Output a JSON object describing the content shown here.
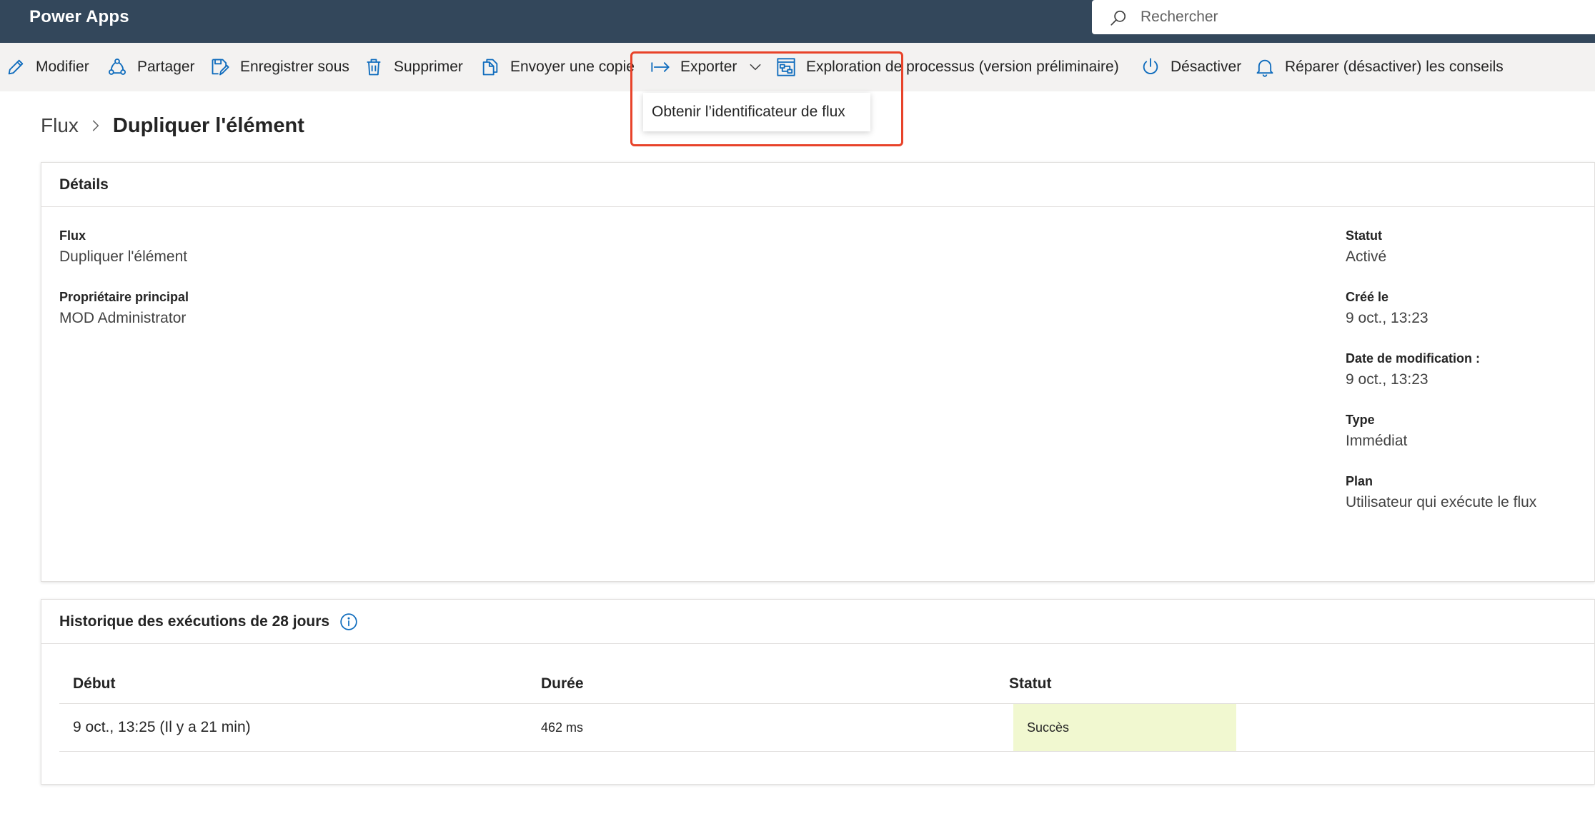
{
  "app": {
    "title": "Power Apps"
  },
  "search": {
    "placeholder": "Rechercher"
  },
  "commandbar": {
    "items": [
      {
        "label": "Modifier",
        "icon": "pencil-icon"
      },
      {
        "label": "Partager",
        "icon": "share-icon"
      },
      {
        "label": "Enregistrer sous",
        "icon": "save-as-icon"
      },
      {
        "label": "Supprimer",
        "icon": "trash-icon"
      },
      {
        "label": "Envoyer une copie",
        "icon": "copy-icon"
      },
      {
        "label": "Exporter",
        "icon": "export-arrow-icon"
      },
      {
        "label": "Exploration de processus (version préliminaire)",
        "icon": "process-mining-icon"
      },
      {
        "label": "Désactiver",
        "icon": "power-icon"
      },
      {
        "label": "Réparer (désactiver) les conseils",
        "icon": "bell-icon"
      }
    ]
  },
  "export_menu": {
    "items": [
      {
        "label": "Obtenir l’identificateur de flux"
      }
    ]
  },
  "breadcrumb": {
    "root": "Flux",
    "current": "Dupliquer l'élément"
  },
  "details": {
    "title": "Détails",
    "left": [
      {
        "label": "Flux",
        "value": "Dupliquer l'élément"
      },
      {
        "label": "Propriétaire principal",
        "value": "MOD Administrator"
      }
    ],
    "right": [
      {
        "label": "Statut",
        "value": "Activé"
      },
      {
        "label": "Créé le",
        "value": "9 oct., 13:23"
      },
      {
        "label": "Date de modification :",
        "value": "9 oct., 13:23"
      },
      {
        "label": "Type",
        "value": "Immédiat"
      },
      {
        "label": "Plan",
        "value": "Utilisateur qui exécute le flux"
      }
    ]
  },
  "history": {
    "title": "Historique des exécutions de 28 jours",
    "columns": [
      "Début",
      "Durée",
      "Statut"
    ],
    "rows": [
      {
        "start": "9 oct., 13:25 (Il y a 21 min)",
        "duration": "462 ms",
        "status": "Succès"
      }
    ]
  },
  "colors": {
    "topbar": "#33475b",
    "accent": "#0f6cbd",
    "highlight_box": "#e8432a",
    "success_bg": "#f1f8d0"
  }
}
